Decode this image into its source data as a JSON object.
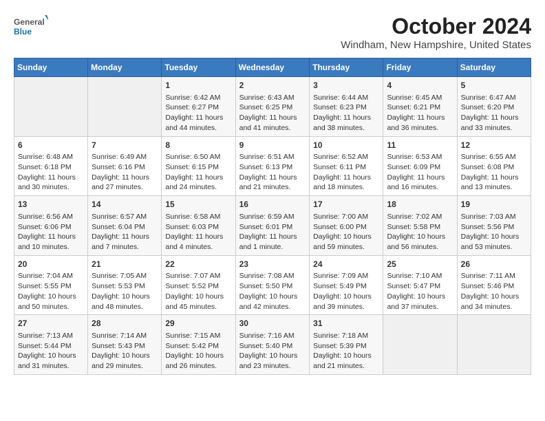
{
  "logo": {
    "general": "General",
    "blue": "Blue"
  },
  "title": "October 2024",
  "location": "Windham, New Hampshire, United States",
  "days_of_week": [
    "Sunday",
    "Monday",
    "Tuesday",
    "Wednesday",
    "Thursday",
    "Friday",
    "Saturday"
  ],
  "weeks": [
    [
      {
        "day": "",
        "info": ""
      },
      {
        "day": "",
        "info": ""
      },
      {
        "day": "1",
        "info": "Sunrise: 6:42 AM\nSunset: 6:27 PM\nDaylight: 11 hours and 44 minutes."
      },
      {
        "day": "2",
        "info": "Sunrise: 6:43 AM\nSunset: 6:25 PM\nDaylight: 11 hours and 41 minutes."
      },
      {
        "day": "3",
        "info": "Sunrise: 6:44 AM\nSunset: 6:23 PM\nDaylight: 11 hours and 38 minutes."
      },
      {
        "day": "4",
        "info": "Sunrise: 6:45 AM\nSunset: 6:21 PM\nDaylight: 11 hours and 36 minutes."
      },
      {
        "day": "5",
        "info": "Sunrise: 6:47 AM\nSunset: 6:20 PM\nDaylight: 11 hours and 33 minutes."
      }
    ],
    [
      {
        "day": "6",
        "info": "Sunrise: 6:48 AM\nSunset: 6:18 PM\nDaylight: 11 hours and 30 minutes."
      },
      {
        "day": "7",
        "info": "Sunrise: 6:49 AM\nSunset: 6:16 PM\nDaylight: 11 hours and 27 minutes."
      },
      {
        "day": "8",
        "info": "Sunrise: 6:50 AM\nSunset: 6:15 PM\nDaylight: 11 hours and 24 minutes."
      },
      {
        "day": "9",
        "info": "Sunrise: 6:51 AM\nSunset: 6:13 PM\nDaylight: 11 hours and 21 minutes."
      },
      {
        "day": "10",
        "info": "Sunrise: 6:52 AM\nSunset: 6:11 PM\nDaylight: 11 hours and 18 minutes."
      },
      {
        "day": "11",
        "info": "Sunrise: 6:53 AM\nSunset: 6:09 PM\nDaylight: 11 hours and 16 minutes."
      },
      {
        "day": "12",
        "info": "Sunrise: 6:55 AM\nSunset: 6:08 PM\nDaylight: 11 hours and 13 minutes."
      }
    ],
    [
      {
        "day": "13",
        "info": "Sunrise: 6:56 AM\nSunset: 6:06 PM\nDaylight: 11 hours and 10 minutes."
      },
      {
        "day": "14",
        "info": "Sunrise: 6:57 AM\nSunset: 6:04 PM\nDaylight: 11 hours and 7 minutes."
      },
      {
        "day": "15",
        "info": "Sunrise: 6:58 AM\nSunset: 6:03 PM\nDaylight: 11 hours and 4 minutes."
      },
      {
        "day": "16",
        "info": "Sunrise: 6:59 AM\nSunset: 6:01 PM\nDaylight: 11 hours and 1 minute."
      },
      {
        "day": "17",
        "info": "Sunrise: 7:00 AM\nSunset: 6:00 PM\nDaylight: 10 hours and 59 minutes."
      },
      {
        "day": "18",
        "info": "Sunrise: 7:02 AM\nSunset: 5:58 PM\nDaylight: 10 hours and 56 minutes."
      },
      {
        "day": "19",
        "info": "Sunrise: 7:03 AM\nSunset: 5:56 PM\nDaylight: 10 hours and 53 minutes."
      }
    ],
    [
      {
        "day": "20",
        "info": "Sunrise: 7:04 AM\nSunset: 5:55 PM\nDaylight: 10 hours and 50 minutes."
      },
      {
        "day": "21",
        "info": "Sunrise: 7:05 AM\nSunset: 5:53 PM\nDaylight: 10 hours and 48 minutes."
      },
      {
        "day": "22",
        "info": "Sunrise: 7:07 AM\nSunset: 5:52 PM\nDaylight: 10 hours and 45 minutes."
      },
      {
        "day": "23",
        "info": "Sunrise: 7:08 AM\nSunset: 5:50 PM\nDaylight: 10 hours and 42 minutes."
      },
      {
        "day": "24",
        "info": "Sunrise: 7:09 AM\nSunset: 5:49 PM\nDaylight: 10 hours and 39 minutes."
      },
      {
        "day": "25",
        "info": "Sunrise: 7:10 AM\nSunset: 5:47 PM\nDaylight: 10 hours and 37 minutes."
      },
      {
        "day": "26",
        "info": "Sunrise: 7:11 AM\nSunset: 5:46 PM\nDaylight: 10 hours and 34 minutes."
      }
    ],
    [
      {
        "day": "27",
        "info": "Sunrise: 7:13 AM\nSunset: 5:44 PM\nDaylight: 10 hours and 31 minutes."
      },
      {
        "day": "28",
        "info": "Sunrise: 7:14 AM\nSunset: 5:43 PM\nDaylight: 10 hours and 29 minutes."
      },
      {
        "day": "29",
        "info": "Sunrise: 7:15 AM\nSunset: 5:42 PM\nDaylight: 10 hours and 26 minutes."
      },
      {
        "day": "30",
        "info": "Sunrise: 7:16 AM\nSunset: 5:40 PM\nDaylight: 10 hours and 23 minutes."
      },
      {
        "day": "31",
        "info": "Sunrise: 7:18 AM\nSunset: 5:39 PM\nDaylight: 10 hours and 21 minutes."
      },
      {
        "day": "",
        "info": ""
      },
      {
        "day": "",
        "info": ""
      }
    ]
  ]
}
